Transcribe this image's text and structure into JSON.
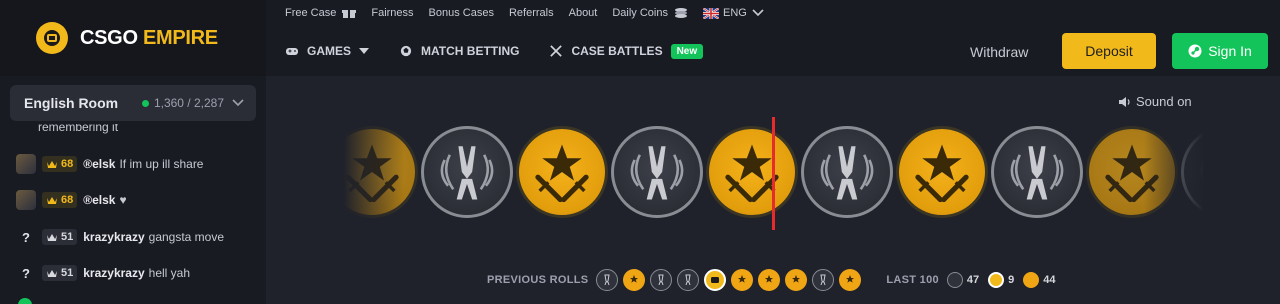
{
  "brand": {
    "word1": "CSGO",
    "word2": "EMPIRE",
    "accent": "#f2b91b"
  },
  "chat": {
    "room_name": "English Room",
    "online": "1,360 / 2,287",
    "cut_message": "remembering it",
    "messages": [
      {
        "avatar": "image",
        "level": "68",
        "user": "®elsk",
        "text": "If im up ill share",
        "tier": "gold"
      },
      {
        "avatar": "image",
        "level": "68",
        "user": "®elsk",
        "text": "♥",
        "tier": "gold"
      },
      {
        "avatar": "?",
        "level": "51",
        "user": "krazykrazy",
        "text": "gangsta move",
        "tier": "grey"
      },
      {
        "avatar": "?",
        "level": "51",
        "user": "krazykrazy",
        "text": "hell yah",
        "tier": "grey"
      }
    ]
  },
  "topbar": {
    "links": [
      "Free Case",
      "Fairness",
      "Bonus Cases",
      "Referrals",
      "About",
      "Daily Coins",
      "ENG"
    ]
  },
  "nav": {
    "games": "GAMES",
    "match_betting": "MATCH BETTING",
    "case_battles": "CASE BATTLES",
    "new_badge": "New",
    "withdraw": "Withdraw",
    "deposit": "Deposit",
    "sign_in": "Sign In"
  },
  "sound": "Sound on",
  "roulette": {
    "coins": [
      "t",
      "ct",
      "t",
      "ct",
      "t",
      "ct",
      "t",
      "ct",
      "t",
      "ct"
    ]
  },
  "previous_rolls": {
    "label": "PREVIOUS ROLLS",
    "rolls": [
      "ct",
      "t",
      "ct",
      "ct",
      "bonus",
      "t",
      "t",
      "t",
      "ct",
      "t"
    ],
    "last100_label": "LAST 100",
    "ct_count": "47",
    "bonus_count": "9",
    "t_count": "44"
  },
  "colors": {
    "green": "#13c45a",
    "gold": "#f2b91b",
    "red_indicator": "#e52b2b"
  }
}
